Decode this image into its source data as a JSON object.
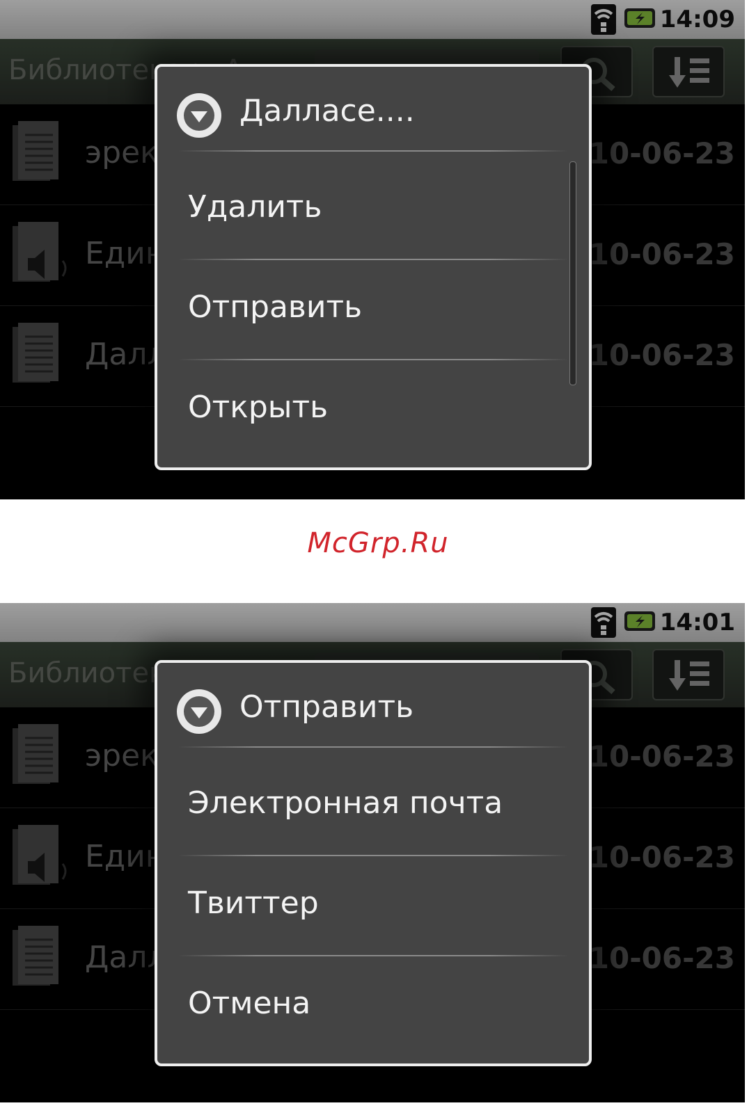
{
  "watermark": "McGrp.Ru",
  "colors": {
    "watermark": "#d1242b",
    "dialog_bg": "#444444",
    "titlebar": "#2f372e",
    "battery": "#8dc63f"
  },
  "screens": [
    {
      "status_time": "14:09",
      "title": "Библиотека > Анн...",
      "icons": [
        "wifi-signal-icon",
        "battery-charging-icon",
        "search-icon",
        "sort-icon"
      ],
      "rows": [
        {
          "name": "эрекция",
          "date": "2010-06-23",
          "icon": "document-icon"
        },
        {
          "name": "Единственн...",
          "date": "2010-06-23",
          "icon": "audio-document-icon"
        },
        {
          "name": "Далласе. Е...",
          "date": "2010-06-23",
          "icon": "document-icon"
        }
      ],
      "dialog": {
        "title": "Далласе....",
        "items": [
          "Удалить",
          "Отправить",
          "Открыть"
        ],
        "has_scrollbar": true
      }
    },
    {
      "status_time": "14:01",
      "title": "Библиотека > Анн...",
      "icons": [
        "wifi-signal-icon",
        "battery-charging-icon",
        "search-icon",
        "sort-icon"
      ],
      "rows": [
        {
          "name": "эрекция",
          "date": "2010-06-23",
          "icon": "document-icon"
        },
        {
          "name": "Единственн...",
          "date": "2010-06-23",
          "icon": "audio-document-icon"
        },
        {
          "name": "Далласе. Е...",
          "date": "2010-06-23",
          "icon": "document-icon"
        }
      ],
      "dialog": {
        "title": "Отправить",
        "items": [
          "Электронная почта",
          "Твиттер",
          "Отмена"
        ],
        "has_scrollbar": false
      }
    }
  ]
}
